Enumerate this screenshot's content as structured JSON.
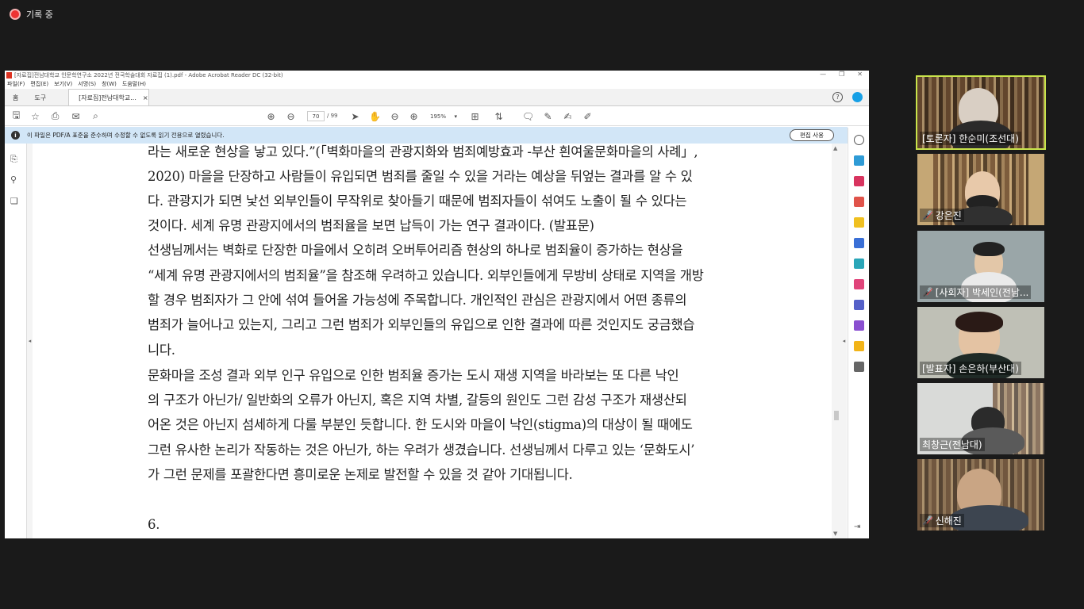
{
  "recording": {
    "label": "기록 중"
  },
  "window": {
    "title": "[자료집]전남대학교 인문학연구소 2022년 전국학술대회 자료집 (1).pdf - Adobe Acrobat Reader DC (32-bit)",
    "controls": [
      "—",
      "❐",
      "✕"
    ]
  },
  "menu": [
    "파일(F)",
    "편집(E)",
    "보기(V)",
    "서명(S)",
    "창(W)",
    "도움말(H)"
  ],
  "tabs": {
    "home": "홈",
    "tools": "도구",
    "document": "[자료집]전남대학교...",
    "close": "×"
  },
  "toolbar": {
    "page_current": "70",
    "page_total": "/ 99",
    "zoom": "195%",
    "zoom_arrow": "▾"
  },
  "infobar": {
    "message": "이 파일은 PDF/A 표준을 준수하며 수정할 수 없도록 읽기 전용으로 열렸습니다.",
    "button": "편집 사용"
  },
  "document": {
    "lines": [
      "라는 새로운 현상을 낳고 있다.”(「벽화마을의 관광지화와 범죄예방효과 -부산 흰여울문화마을의 사례」,",
      "2020) 마을을 단장하고 사람들이 유입되면 범죄를 줄일 수 있을 거라는 예상을 뒤엎는 결과를 알 수 있",
      "다. 관광지가 되면 낯선 외부인들이 무작위로 찾아들기 때문에 범죄자들이 섞여도 노출이 될 수 있다는",
      "것이다. 세계 유명 관광지에서의 범죄율을 보면 납득이 가는 연구 결과이다. (발표문)",
      "   선생님께서는 벽화로 단장한 마을에서 오히려 오버투어리즘 현상의 하나로 범죄율이 증가하는 현상을",
      "“세계 유명 관광지에서의 범죄율”을 참조해 우려하고 있습니다. 외부인들에게 무방비 상태로 지역을 개방",
      "할 경우 범죄자가 그 안에 섞여 들어올 가능성에 주목합니다. 개인적인 관심은 관광지에서 어떤 종류의",
      "범죄가 늘어나고 있는지, 그리고 그런 범죄가 외부인들의 유입으로 인한 결과에 따른 것인지도 궁금했습",
      "니다.",
      "   문화마을 조성 결과 외부 인구 유입으로 인한 범죄율 증가는 도시 재생 지역을 바라보는 또 다른 낙인",
      "의 구조가 아닌가/ 일반화의 오류가 아닌지, 혹은 지역 차별, 갈등의 원인도 그런 감성 구조가 재생산되",
      "어온 것은 아닌지 섬세하게 다룰 부분인 듯합니다. 한 도시와 마을이 낙인(stigma)의 대상이 될 때에도",
      "그런 유사한 논리가 작동하는 것은 아닌가, 하는 우려가 생겼습니다. 선생님께서 다루고 있는 ‘문화도시’",
      "가 그런 문제를 포괄한다면 흥미로운 논제로 발전할 수 있을 것 같아 기대됩니다.",
      "",
      "   6."
    ]
  },
  "participants": [
    {
      "name": "[토론자] 한순미(조선대)",
      "muted": false,
      "active": true
    },
    {
      "name": "강은진",
      "muted": true,
      "active": false
    },
    {
      "name": "[사회자] 박세인(전남...",
      "muted": true,
      "active": false
    },
    {
      "name": "[발표자] 손은하(부산대)",
      "muted": false,
      "active": false
    },
    {
      "name": "최창근(전남대)",
      "muted": false,
      "active": false
    },
    {
      "name": "신해진",
      "muted": true,
      "active": false
    }
  ],
  "colors": {
    "active_speaker": "#c9e44b",
    "info_bar": "#d2e6f7",
    "mute": "#ff3333",
    "profile": "#17a0e6"
  }
}
